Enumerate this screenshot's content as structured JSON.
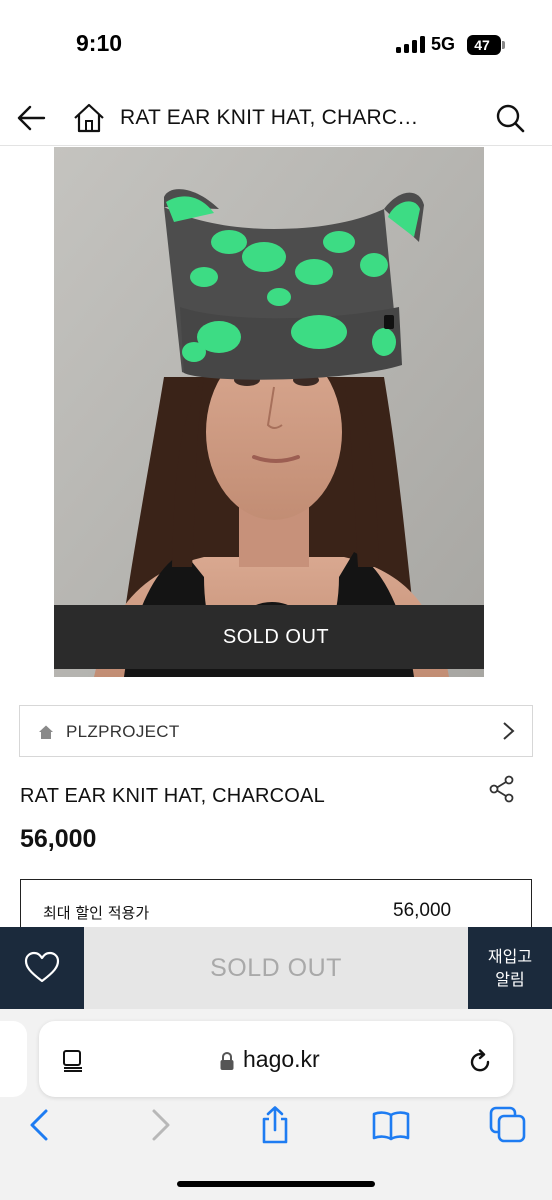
{
  "status_bar": {
    "time": "9:10",
    "network": "5G",
    "battery": "47"
  },
  "header": {
    "title": "RAT EAR KNIT HAT, CHARC…"
  },
  "product": {
    "sold_out_banner": "SOLD OUT",
    "brand": "PLZPROJECT",
    "name": "RAT EAR KNIT HAT, CHARCOAL",
    "price": "56,000",
    "max_discount_label": "최대 할인 적용가",
    "max_discount_price": "56,000"
  },
  "action_bar": {
    "sold_out_label": "SOLD OUT",
    "restock_line1": "재입고",
    "restock_line2": "알림"
  },
  "browser": {
    "url": "hago.kr"
  },
  "colors": {
    "navy": "#1b2a3c",
    "hat_green": "#3ddc84",
    "hat_charcoal": "#4a4a4a",
    "link_blue": "#1e7cf2"
  }
}
